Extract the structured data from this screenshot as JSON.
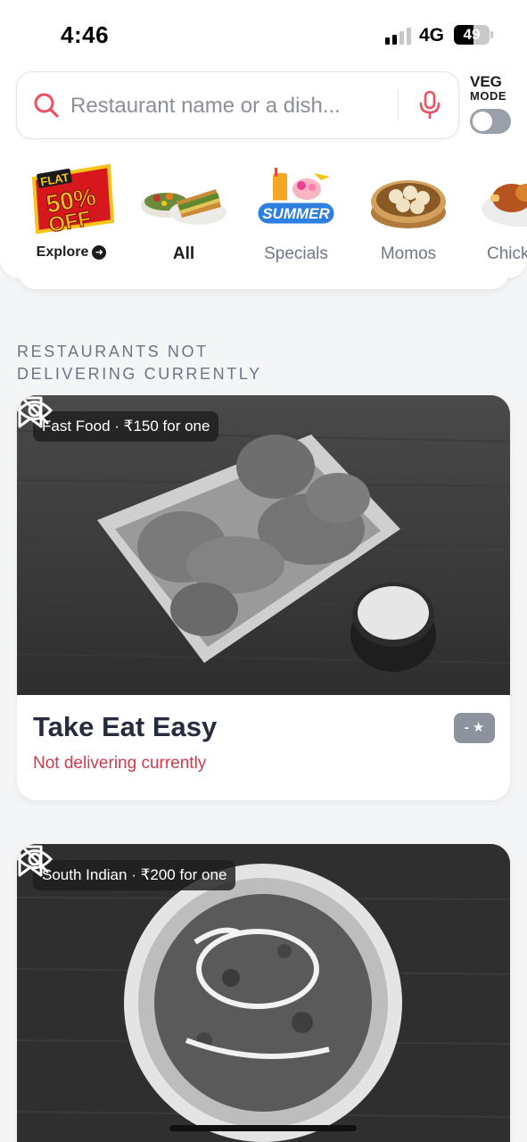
{
  "status_bar": {
    "time": "4:46",
    "network": "4G",
    "battery": "49"
  },
  "search": {
    "placeholder": "Restaurant name or a dish...",
    "veg_label_top": "VEG",
    "veg_label_bottom": "MODE",
    "veg_enabled": false
  },
  "categories": [
    {
      "label": "Explore",
      "icon": "flat-50-off-badge",
      "badge_line1": "FLAT",
      "badge_line2": "50%",
      "badge_line3": "OFF"
    },
    {
      "label": "All",
      "icon": "sandwich-platter",
      "active": true
    },
    {
      "label": "Specials",
      "icon": "summer-drinks",
      "badge": "SUMMER"
    },
    {
      "label": "Momos",
      "icon": "momos-basket"
    },
    {
      "label": "Chick",
      "icon": "chicken-plate"
    }
  ],
  "section": {
    "heading": "RESTAURANTS NOT DELIVERING CURRENTLY"
  },
  "restaurants": [
    {
      "tag": "Fast Food · ₹150 for one",
      "name": "Take Eat Easy",
      "status": "Not delivering currently",
      "rating": "- ★",
      "image": "fried-chicken-tray"
    },
    {
      "tag": "South Indian · ₹200 for one",
      "image": "curry-bowl"
    }
  ],
  "colors": {
    "accent": "#ef4f5f",
    "status_red": "#d13b4d",
    "heading_gray": "#6f7482"
  }
}
